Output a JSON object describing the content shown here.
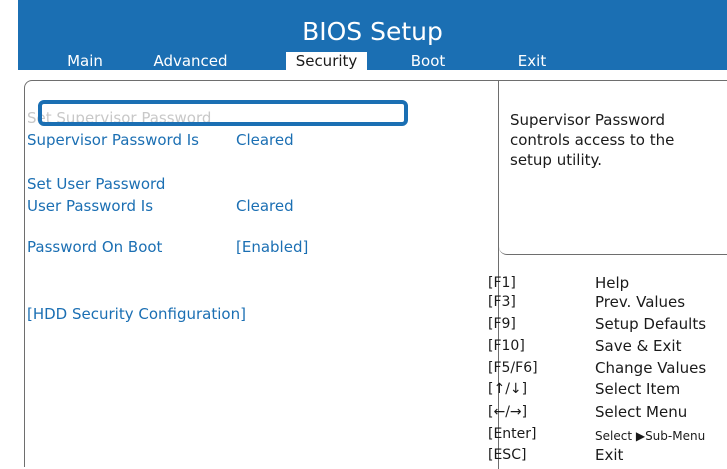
{
  "title": "BIOS Setup",
  "tabs": [
    {
      "label": "Main"
    },
    {
      "label": "Advanced"
    },
    {
      "label": "Security"
    },
    {
      "label": "Boot"
    },
    {
      "label": "Exit"
    }
  ],
  "active_tab": "Security",
  "settings": [
    {
      "label": "Set Supervisor Password",
      "value": ""
    },
    {
      "label": "Supervisor Password Is",
      "value": "Cleared"
    },
    {
      "label": "Set User Password",
      "value": ""
    },
    {
      "label": "User Password Is",
      "value": "Cleared"
    },
    {
      "label": "Password On Boot",
      "value": "[Enabled]"
    },
    {
      "label": "[HDD Security Configuration]",
      "value": ""
    }
  ],
  "selected_item": "Set Supervisor Password",
  "help_text": "Supervisor Password controls access to the setup utility.",
  "keys": [
    {
      "key": "[F1]",
      "desc": "Help"
    },
    {
      "key": "[F3]",
      "desc": "Prev. Values"
    },
    {
      "key": "[F9]",
      "desc": "Setup Defaults"
    },
    {
      "key": "[F10]",
      "desc": "Save & Exit"
    },
    {
      "key": "[F5/F6]",
      "desc": "Change Values"
    },
    {
      "key": "[↑/↓]",
      "desc": "Select Item"
    },
    {
      "key": "[←/→]",
      "desc": "Select Menu"
    },
    {
      "key": "[Enter]",
      "desc": "Select ▶Sub-Menu"
    },
    {
      "key": "[ESC]",
      "desc": "Exit"
    }
  ],
  "colors": {
    "header_bg": "#1b6fb3",
    "accent": "#1b6fb3",
    "selected_text": "#c8c8c8"
  }
}
